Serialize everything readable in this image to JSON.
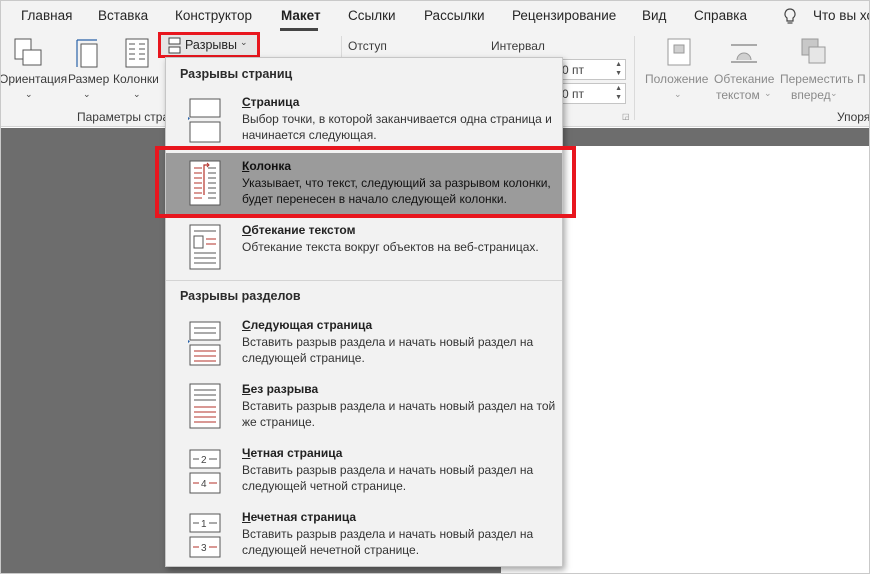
{
  "tabs": [
    {
      "label": "Главная"
    },
    {
      "label": "Вставка"
    },
    {
      "label": "Конструктор"
    },
    {
      "label": "Макет",
      "active": true
    },
    {
      "label": "Ссылки"
    },
    {
      "label": "Рассылки"
    },
    {
      "label": "Рецензирование"
    },
    {
      "label": "Вид"
    },
    {
      "label": "Справка"
    },
    {
      "label": "Что вы хо"
    }
  ],
  "ribbon": {
    "orientation_label": "Ориентация",
    "size_label": "Размер",
    "columns_label": "Колонки",
    "page_setup_group": "Параметры стра",
    "breaks_label": "Разрывы",
    "indent_label": "Отступ",
    "spacing_label": "Интервал",
    "spacing_before_value": "0 пт",
    "spacing_after_value": "0 пт",
    "position_label": [
      "Положение"
    ],
    "wrap_text_label": [
      "Обтекание",
      "текстом"
    ],
    "bring_forward_label": [
      "Переместить",
      "вперед"
    ],
    "partial_label": "П",
    "arrange_group": "Упоря"
  },
  "menu": {
    "page_breaks_header": "Разрывы страниц",
    "section_breaks_header": "Разрывы разделов",
    "items": [
      {
        "id": "page",
        "title": "Страница",
        "access_key": "С",
        "desc": "Выбор точки, в которой заканчивается одна страница и начинается следующая."
      },
      {
        "id": "column",
        "title": "Колонка",
        "access_key": "К",
        "desc": "Указывает, что текст, следующий за разрывом колонки, будет перенесен в начало следующей колонки.",
        "highlighted": true
      },
      {
        "id": "text-wrapping",
        "title": "Обтекание текстом",
        "access_key": "О",
        "desc": "Обтекание текста вокруг объектов на веб-страницах."
      },
      {
        "id": "next-page",
        "title": "Следующая страница",
        "access_key": "С",
        "desc": "Вставить разрыв раздела и начать новый раздел на следующей странице."
      },
      {
        "id": "continuous",
        "title": "Без разрыва",
        "access_key": "Б",
        "desc": "Вставить разрыв раздела и начать новый раздел на той же странице."
      },
      {
        "id": "even-page",
        "title": "Четная страница",
        "access_key": "Ч",
        "desc": "Вставить разрыв раздела и начать новый раздел на следующей четной странице."
      },
      {
        "id": "odd-page",
        "title": "Нечетная страница",
        "access_key": "Н",
        "desc": "Вставить разрыв раздела и начать новый раздел на следующей нечетной странице."
      }
    ]
  },
  "colors": {
    "highlight_frame": "#e8161e",
    "menu_highlight": "#9b9b9b",
    "workspace": "#6d6d6d",
    "icon_accent": "#b3322a"
  }
}
